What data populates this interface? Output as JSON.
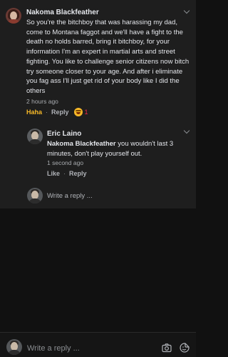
{
  "main_comment": {
    "author": "Nakoma Blackfeather",
    "text": "So you're the bitchboy that was harassing my dad, come to Montana faggot and we'll have a fight to the death no holds barred, bring it bitchboy, for your information I'm an expert in martial arts and street fighting. You like to challenge senior citizens now bitch try someone closer to your age. And after i eliminate you fag ass I'll just get rid of your body like I did the others",
    "time": "2 hours ago",
    "reaction_label": "Haha",
    "reply_label": "Reply",
    "reaction_icon": "haha-emoji-icon",
    "reaction_count": "1"
  },
  "reply_comment": {
    "author": "Eric Laino",
    "mention": "Nakoma Blackfeather",
    "text": " you wouldn't last 3 minutes, don't play yourself out.",
    "time": "1 second ago",
    "like_label": "Like",
    "reply_label": "Reply"
  },
  "reply_composer": {
    "placeholder": "Write a reply ..."
  },
  "bottom_composer": {
    "placeholder": "Write a reply ...",
    "icons": [
      "camera-icon",
      "sticker-icon"
    ]
  },
  "colors": {
    "background": "#111111",
    "thread_background": "#1e1e1e",
    "haha_accent": "#f7b928",
    "count_accent": "#f02849",
    "text": "#e4e6eb",
    "muted": "#b0b3b8"
  }
}
